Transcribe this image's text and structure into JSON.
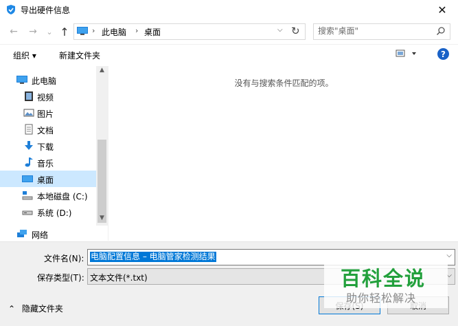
{
  "window": {
    "title": "导出硬件信息",
    "close_glyph": "✕"
  },
  "nav": {
    "back": "←",
    "forward": "→",
    "recent": "⌄",
    "up": "↑"
  },
  "address": {
    "crumbs": [
      "此电脑",
      "桌面"
    ],
    "separator": "›"
  },
  "search": {
    "placeholder": "搜索\"桌面\""
  },
  "toolbar": {
    "organize": "组织 ▾",
    "new_folder": "新建文件夹"
  },
  "sidebar": {
    "items": [
      {
        "label": "此电脑",
        "icon": "computer-icon"
      },
      {
        "label": "视频",
        "icon": "video-icon"
      },
      {
        "label": "图片",
        "icon": "pictures-icon"
      },
      {
        "label": "文档",
        "icon": "documents-icon"
      },
      {
        "label": "下载",
        "icon": "download-icon"
      },
      {
        "label": "音乐",
        "icon": "music-icon"
      },
      {
        "label": "桌面",
        "icon": "desktop-icon",
        "selected": true
      },
      {
        "label": "本地磁盘 (C:)",
        "icon": "local-disk-icon"
      },
      {
        "label": "系统 (D:)",
        "icon": "drive-icon"
      },
      {
        "label": "网络",
        "icon": "network-icon"
      }
    ]
  },
  "main": {
    "empty_message": "没有与搜索条件匹配的项。"
  },
  "form": {
    "filename_label": "文件名(N):",
    "filename_value": "电脑配置信息 – 电脑管家检测结果",
    "filetype_label": "保存类型(T):",
    "filetype_value": "文本文件(*.txt)"
  },
  "footer": {
    "hide_folders": "隐藏文件夹",
    "save_button": "保存(S)",
    "cancel_button": "取消"
  },
  "watermark": {
    "main": "百科全说",
    "sub": "助你轻松解决"
  },
  "colors": {
    "selection": "#0078d7",
    "selected_nav": "#cce8ff",
    "help": "#1a62c7",
    "watermark": "#22a03c"
  }
}
